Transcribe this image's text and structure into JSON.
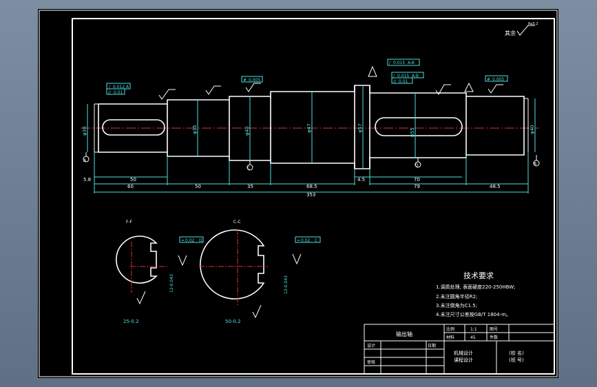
{
  "roughness_general": "其余",
  "roughness_general_value": "Ra3.2",
  "tolerances": {
    "tol1_sym": "/",
    "tol1_val": "0.012",
    "tol1_ref": "A",
    "tol2_sym": "//",
    "tol2_val": "0.01",
    "tol3_sym": "#",
    "tol3_val": "0.005",
    "tol4_sym": "/",
    "tol4_val": "0.015",
    "tol4_ref": "A-B",
    "tol5_sym": "/",
    "tol5_val": "0.015",
    "tol5_ref": "A-B",
    "tol6_sym": "//",
    "tol6_val": "0.01",
    "tol7_sym": "#",
    "tol7_val": "0.005",
    "tol8_sym": "=",
    "tol8_val": "0.02",
    "tol8_ref": "D",
    "tol9_sym": "=",
    "tol9_val": "0.02",
    "tol9_ref": "C"
  },
  "diameters": {
    "d1": "φ30",
    "d2": "φ35",
    "d3": "φ40",
    "d4": "φ47",
    "d5": "φ57",
    "d6": "φ55",
    "d7": "φ40"
  },
  "dimensions": {
    "l_58": "5.8",
    "l_50a": "50",
    "l_60": "60",
    "l_50b": "50",
    "l_35": "35",
    "l_685": "68.5",
    "l_45": "4.5",
    "l_70": "70",
    "l_79": "79",
    "l_485": "48.5",
    "l_353": "353"
  },
  "datums": {
    "A": "A",
    "B": "B",
    "C": "C",
    "D": "D"
  },
  "section_labels": {
    "s1": "F-F",
    "s2": "C-C"
  },
  "section_dims": {
    "s1_width": "25-0.2",
    "s1_depth": "12-0.043",
    "s2_width": "50-0.2",
    "s2_depth": "12-0.043"
  },
  "tech_req": {
    "title": "技术要求",
    "items": [
      "1.调质处理, 表面硬度220-250HBW;",
      "2.未注圆角半径R2;",
      "3.未注倒角为C1.5;",
      "4.未注尺寸公差按GB/T 1804-m。"
    ]
  },
  "title_block": {
    "part_name": "输出轴",
    "scale_label": "比例",
    "scale_value": "1:1",
    "material_label": "材料",
    "material_value": "45",
    "count_label": "件数",
    "drawing_no_label": "图号",
    "designer_label": "设计",
    "checker_label": "审核",
    "date_label": "日期",
    "course_1": "机械设计",
    "course_2": "课程设计",
    "school": "(校 名)",
    "class_id": "(班 号)"
  }
}
